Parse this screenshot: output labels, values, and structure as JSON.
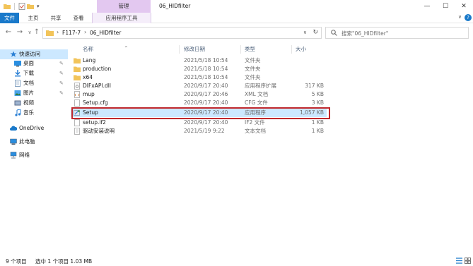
{
  "titlebar": {
    "context_tab": "管理",
    "window_title": "06_HIDfilter",
    "minimize": "—",
    "maximize": "☐",
    "close": "✕"
  },
  "ribbon": {
    "tabs": [
      "文件",
      "主页",
      "共享",
      "查看",
      "应用程序工具"
    ],
    "expand": "∨",
    "help": "?"
  },
  "address": {
    "crumbs": [
      "F117-7",
      "06_HIDfilter"
    ],
    "search_placeholder": "搜索\"06_HIDfilter\""
  },
  "navpane": {
    "items": [
      {
        "label": "快速访问",
        "icon": "star-icon",
        "pinned": false
      },
      {
        "label": "桌面",
        "icon": "desktop-icon",
        "pinned": true
      },
      {
        "label": "下载",
        "icon": "download-icon",
        "pinned": true
      },
      {
        "label": "文档",
        "icon": "document-icon",
        "pinned": true
      },
      {
        "label": "图片",
        "icon": "picture-icon",
        "pinned": true
      },
      {
        "label": "视频",
        "icon": "video-icon",
        "pinned": false
      },
      {
        "label": "音乐",
        "icon": "music-icon",
        "pinned": false
      },
      {
        "label": "OneDrive",
        "icon": "cloud-icon",
        "pinned": false
      },
      {
        "label": "此电脑",
        "icon": "computer-icon",
        "pinned": false
      },
      {
        "label": "网络",
        "icon": "network-icon",
        "pinned": false
      }
    ]
  },
  "columns": {
    "name": "名称",
    "date": "修改日期",
    "type": "类型",
    "size": "大小"
  },
  "files": [
    {
      "name": "Lang",
      "date": "2021/5/18 10:54",
      "type": "文件夹",
      "size": "",
      "icon": "folder-icon"
    },
    {
      "name": "production",
      "date": "2021/5/18 10:54",
      "type": "文件夹",
      "size": "",
      "icon": "folder-icon"
    },
    {
      "name": "x64",
      "date": "2021/5/18 10:54",
      "type": "文件夹",
      "size": "",
      "icon": "folder-icon"
    },
    {
      "name": "DIFxAPI.dll",
      "date": "2020/9/17 20:40",
      "type": "应用程序扩展",
      "size": "317 KB",
      "icon": "dll-icon"
    },
    {
      "name": "mup",
      "date": "2020/9/17 20:46",
      "type": "XML 文档",
      "size": "5 KB",
      "icon": "xml-icon"
    },
    {
      "name": "Setup.cfg",
      "date": "2020/9/17 20:40",
      "type": "CFG 文件",
      "size": "3 KB",
      "icon": "file-icon"
    },
    {
      "name": "Setup",
      "date": "2020/9/17 20:40",
      "type": "应用程序",
      "size": "1,057 KB",
      "icon": "setup-exe-icon",
      "selected": true
    },
    {
      "name": "setup.if2",
      "date": "2020/9/17 20:40",
      "type": "IF2 文件",
      "size": "1 KB",
      "icon": "file-icon"
    },
    {
      "name": "驱动安装说明",
      "date": "2021/5/19 9:22",
      "type": "文本文档",
      "size": "1 KB",
      "icon": "text-file-icon"
    }
  ],
  "status": {
    "count": "9 个项目",
    "selection": "选中 1 个项目  1.03 MB"
  },
  "colors": {
    "accent": "#1979ca",
    "selection": "#cce8ff",
    "context_tab": "#e3c8f0",
    "highlight_box": "#c0282c",
    "folder": "#f2c45a"
  }
}
